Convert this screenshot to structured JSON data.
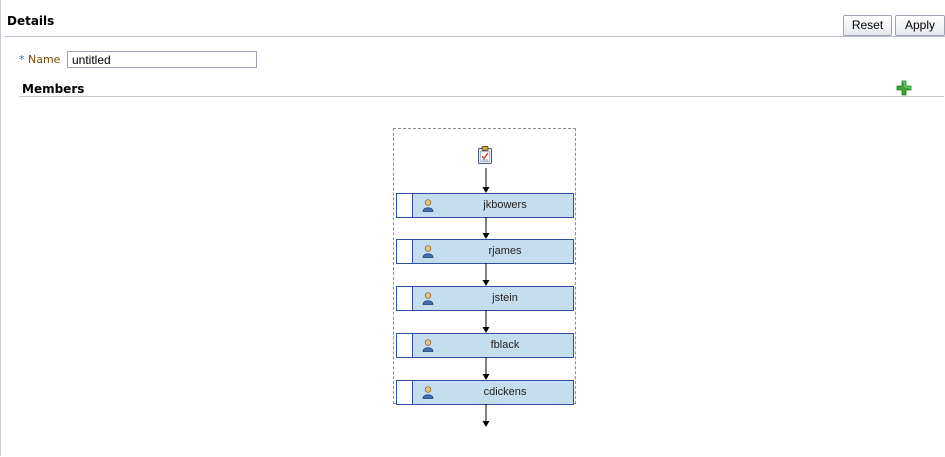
{
  "details": {
    "title": "Details",
    "reset_label": "Reset",
    "apply_label": "Apply",
    "name_required_marker": "*",
    "name_label": "Name",
    "name_value": "untitled"
  },
  "members": {
    "title": "Members",
    "add_icon": "add-member-icon",
    "start_icon": "task-clipboard-icon",
    "list": [
      {
        "name": "jkbowers",
        "icon": "user-icon"
      },
      {
        "name": "rjames",
        "icon": "user-icon"
      },
      {
        "name": "jstein",
        "icon": "user-icon"
      },
      {
        "name": "fblack",
        "icon": "user-icon"
      },
      {
        "name": "cdickens",
        "icon": "user-icon"
      }
    ]
  },
  "colors": {
    "member_fill": "#c4ddef",
    "member_border": "#2f4fa0",
    "add_icon": "#3aa635",
    "label_brown": "#7a4d00"
  }
}
